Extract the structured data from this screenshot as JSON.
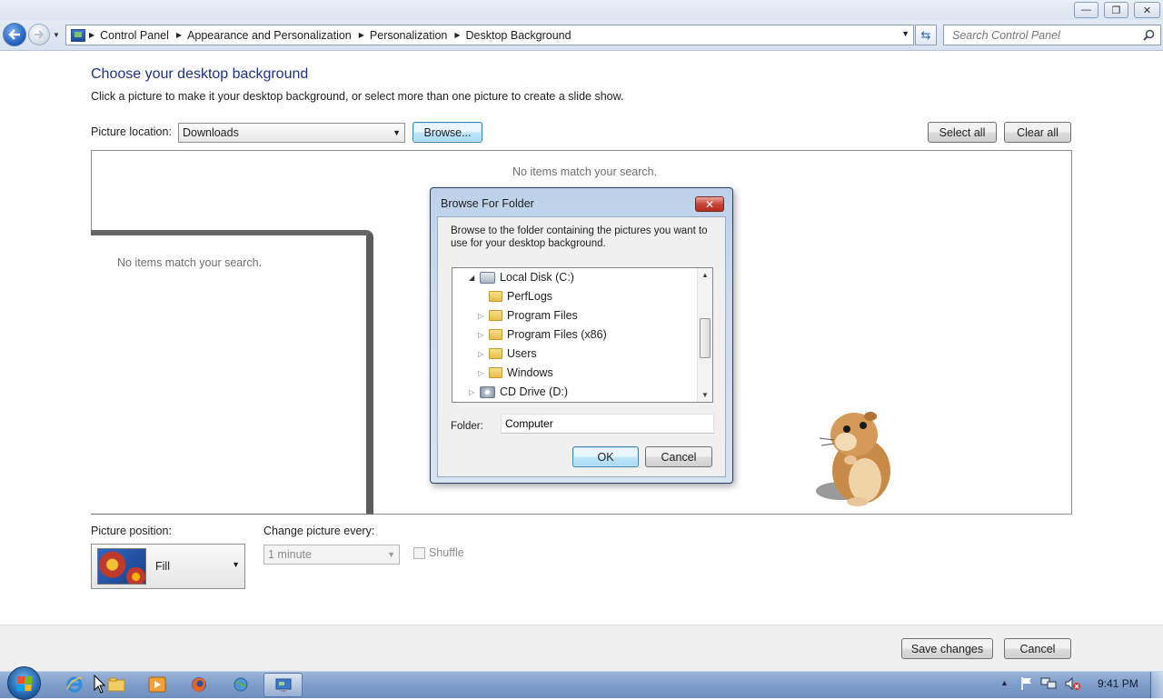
{
  "window": {
    "minimize_glyph": "—",
    "maximize_glyph": "❐",
    "close_glyph": "✕"
  },
  "address_bar": {
    "breadcrumbs": [
      "Control Panel",
      "Appearance and Personalization",
      "Personalization",
      "Desktop Background"
    ],
    "search_placeholder": "Search Control Panel"
  },
  "main": {
    "title": "Choose your desktop background",
    "description": "Click a picture to make it your desktop background, or select more than one picture to create a slide show.",
    "picture_location_label": "Picture location:",
    "picture_location_value": "Downloads",
    "browse_label": "Browse...",
    "select_all_label": "Select all",
    "clear_all_label": "Clear all",
    "no_items_text": "No items match your search.",
    "ghost_no_items_text": "No items match your search.",
    "picture_position_label": "Picture position:",
    "picture_position_value": "Fill",
    "change_picture_label": "Change picture every:",
    "change_picture_value": "1 minute",
    "shuffle_label": "Shuffle",
    "save_label": "Save changes",
    "cancel_label": "Cancel"
  },
  "dialog": {
    "title": "Browse For Folder",
    "message": "Browse to the folder containing the pictures you want to use for your desktop background.",
    "tree": [
      {
        "label": "Local Disk (C:)",
        "icon": "drive-icon",
        "expanded": true
      },
      {
        "label": "PerfLogs",
        "icon": "folder-icon",
        "expanded": false
      },
      {
        "label": "Program Files",
        "icon": "folder-icon",
        "expanded": false
      },
      {
        "label": "Program Files (x86)",
        "icon": "folder-icon",
        "expanded": false
      },
      {
        "label": "Users",
        "icon": "folder-icon",
        "expanded": false
      },
      {
        "label": "Windows",
        "icon": "folder-icon",
        "expanded": false
      },
      {
        "label": "CD Drive (D:)",
        "icon": "cd-drive-icon",
        "expanded": false
      }
    ],
    "folder_label": "Folder:",
    "folder_value": "Computer",
    "ok_label": "OK",
    "cancel_label": "Cancel"
  },
  "taskbar": {
    "pinned": [
      "internet-explorer-icon",
      "file-explorer-icon",
      "media-player-icon",
      "firefox-icon",
      "network-globe-icon",
      "control-panel-icon"
    ],
    "clock": "9:41 PM"
  },
  "colors": {
    "title_blue": "#1e3287",
    "taskbar": "#7d9cc8",
    "close_red": "#c7453a"
  }
}
